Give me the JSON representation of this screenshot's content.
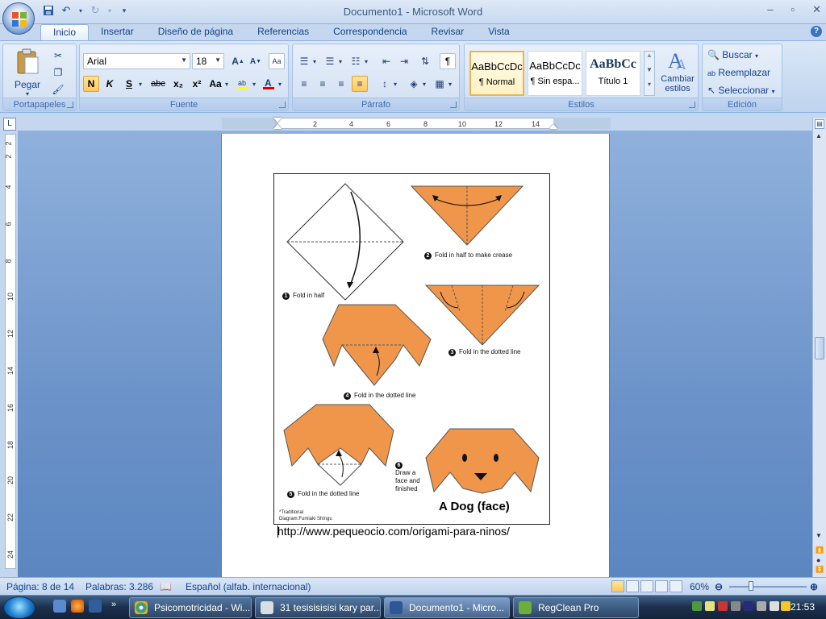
{
  "window": {
    "title": "Documento1 - Microsoft Word",
    "minimize": "–",
    "maximize": "▫",
    "close": "✕"
  },
  "ribbon": {
    "tabs": [
      "Inicio",
      "Insertar",
      "Diseño de página",
      "Referencias",
      "Correspondencia",
      "Revisar",
      "Vista"
    ],
    "active_tab": "Inicio",
    "clipboard": {
      "label": "Portapapeles",
      "paste": "Pegar"
    },
    "font": {
      "label": "Fuente",
      "family": "Arial",
      "size": "18",
      "bold": "N",
      "italic": "K",
      "underline": "S",
      "strikethrough": "abc",
      "subscript": "x₂",
      "superscript": "x²",
      "change_case": "Aa"
    },
    "paragraph": {
      "label": "Párrafo"
    },
    "styles": {
      "label": "Estilos",
      "items": [
        {
          "sample": "AaBbCcDc",
          "name": "¶ Normal"
        },
        {
          "sample": "AaBbCcDc",
          "name": "¶ Sin espa..."
        },
        {
          "sample": "AaBbCc",
          "name": "Título 1"
        }
      ],
      "change_styles": "Cambiar estilos"
    },
    "editing": {
      "label": "Edición",
      "find": "Buscar",
      "replace": "Reemplazar",
      "select": "Seleccionar"
    }
  },
  "ruler": {
    "h_ticks": [
      "2",
      "2",
      "4",
      "6",
      "8",
      "10",
      "12",
      "14",
      "16"
    ],
    "v_ticks": [
      "2",
      "2",
      "4",
      "6",
      "8",
      "10",
      "12",
      "14",
      "16",
      "18",
      "20",
      "22",
      "24"
    ]
  },
  "document": {
    "figure": {
      "steps": [
        {
          "num": "1",
          "text": "Fold in half"
        },
        {
          "num": "2",
          "text": "Fold in half to make crease"
        },
        {
          "num": "3",
          "text": "Fold in the dotted line"
        },
        {
          "num": "4",
          "text": "Fold in the dotted line"
        },
        {
          "num": "5",
          "text": "Fold in the dotted line"
        },
        {
          "num": "6",
          "text": "Draw a face and finished"
        }
      ],
      "step6_lines": [
        "Draw a",
        "face and",
        "finished"
      ],
      "title": "A Dog (face)",
      "credit_1": "*Traditional",
      "credit_2": "Diagram:Fumiaki Shingu"
    },
    "url": "http://www.pequeocio.com/origami-para-ninos/"
  },
  "status": {
    "page": "Página: 8 de 14",
    "words": "Palabras: 3.286",
    "language": "Español (alfab. internacional)",
    "zoom": "60%"
  },
  "taskbar": {
    "tasks": [
      {
        "label": "Psicomotricidad - Wi...",
        "active": false
      },
      {
        "label": "31 tesisisisisi kary par...",
        "active": false
      },
      {
        "label": "Documento1 - Micro...",
        "active": true
      },
      {
        "label": "RegClean Pro",
        "active": false
      }
    ],
    "clock": "21:53"
  },
  "colors": {
    "origami_orange": "#f0964a",
    "ribbon_blue": "#c6d9f1"
  }
}
